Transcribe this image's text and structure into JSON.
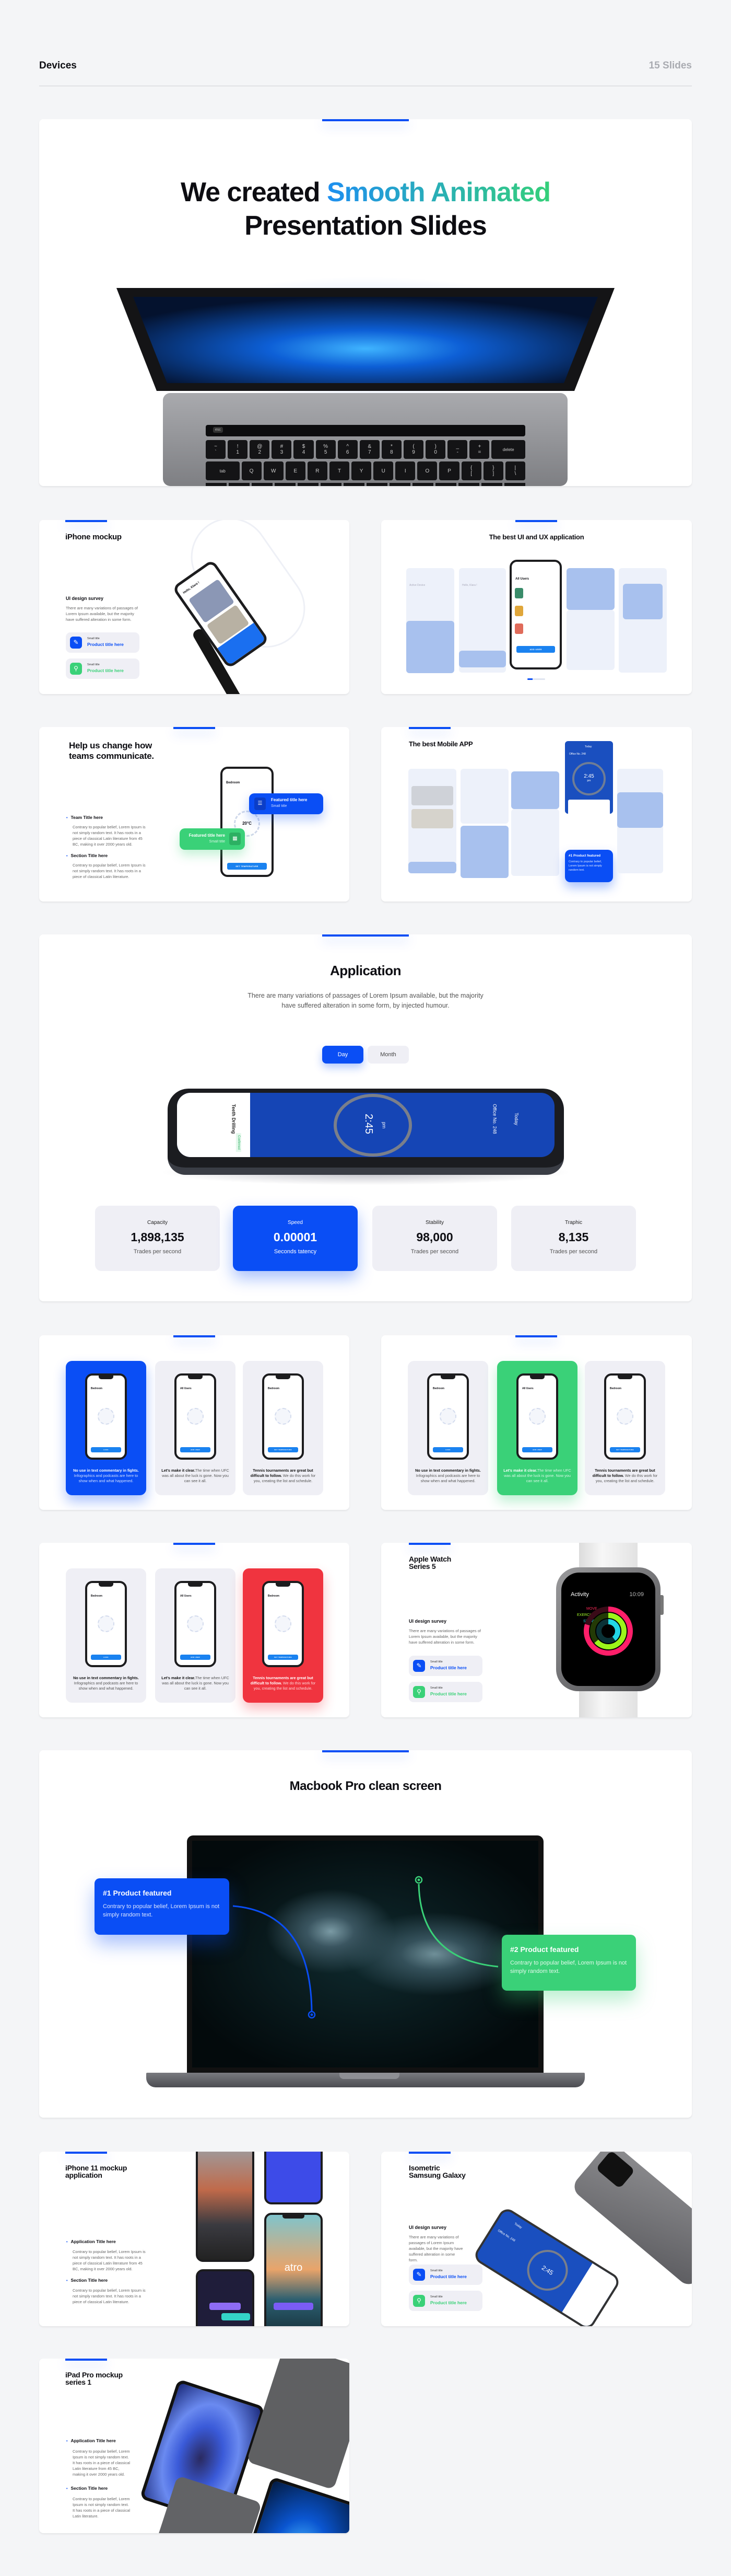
{
  "header": {
    "title": "Devices",
    "count": "15 Slides"
  },
  "colors": {
    "accent": "#0a4ef5",
    "green": "#3ad178",
    "red": "#f0343f",
    "background": "#f4f5f7"
  },
  "hero": {
    "title_start": "We created",
    "title_highlight": "Smooth Animated",
    "title_line2": "Presentation Slides",
    "keyboard": {
      "touchbar_key": "esc",
      "row1": [
        "~\n`",
        "!\n1",
        "@\n2",
        "#\n3",
        "$\n4",
        "%\n5",
        "^\n6",
        "&\n7",
        "*\n8",
        "(\n9",
        ")\n0",
        "_\n-",
        "+\n=",
        "delete"
      ],
      "row2": [
        "tab",
        "Q",
        "W",
        "E",
        "R",
        "T",
        "Y",
        "U",
        "I",
        "O",
        "P",
        "{\n[",
        "}\n]",
        "|\n\\"
      ]
    }
  },
  "survey": {
    "title": "UI design survey",
    "text": "There are many variations of passages of Lorem Ipsum available, but the majority have suffered alteration in some form.",
    "features": [
      {
        "small": "Small title",
        "title": "Product title here",
        "icon": "chart-pen-icon",
        "color": "#0a4ef5"
      },
      {
        "small": "Small title",
        "title": "Product title here",
        "icon": "head-search-icon",
        "color": "#3ad178"
      }
    ]
  },
  "iphone_mockup": {
    "title": "iPhone mockup",
    "phone_greeting": "Hello, Klara !"
  },
  "best_ui": {
    "title": "The best UI and UX application",
    "phone_heading": "All Users",
    "phone_button": "ADD USER",
    "side_labels": [
      "Active Device",
      "Hello, Klara !"
    ]
  },
  "help": {
    "title_line1": "Help us change how",
    "title_line2": "teams communicate.",
    "items": [
      {
        "title": "Team Title here",
        "text": "Contrary to popular belief, Lorem Ipsum is not simply random text. It has roots in a piece of classical Latin literature from 45 BC, making it over 2000 years old."
      },
      {
        "title": "Section Title here",
        "text": "Contrary to popular belief, Lorem Ipsum is not simply random text. It has roots in a piece of classical Latin literature."
      }
    ],
    "phone_heading": "Bedroom",
    "phone_temp": "20°C",
    "phone_button": "SET TEMPERATURE",
    "callouts": [
      {
        "title": "Featured title here",
        "small": "Small title"
      },
      {
        "title": "Featured title here",
        "small": "Small title"
      }
    ]
  },
  "best_mobile": {
    "title": "The best Mobile APP",
    "phone_office": "Office No. 248",
    "phone_day": "Today",
    "phone_time": "2:45",
    "phone_ampm": "pm",
    "callout_title": "#1 Product featured",
    "callout_text": "Contrary to popular belief, Lorem Ipsum is not simply random text."
  },
  "application": {
    "title": "Application",
    "description_line1": "There are many variations of passages of Lorem Ipsum available, but the majority",
    "description_line2": "have suffered alteration in some form, by injected humour.",
    "toggle": {
      "options": [
        "Day",
        "Month"
      ],
      "selected": "Day"
    },
    "phone": {
      "time": "2:45",
      "ampm": "pm",
      "office": "Office No. 248",
      "day": "Today",
      "task": "Teeth Drilling",
      "status": "Confirmed"
    },
    "stats": [
      {
        "label": "Capacity",
        "value": "1,898,135",
        "unit": "Trades per second"
      },
      {
        "label": "Speed",
        "value": "0.00001",
        "unit": "Seconds tatency"
      },
      {
        "label": "Stability",
        "value": "98,000",
        "unit": "Trades per second"
      },
      {
        "label": "Traphic",
        "value": "8,135",
        "unit": "Trades per second"
      }
    ]
  },
  "feature_trio": {
    "panels": [
      {
        "bold": "No use in text commentary in fights.",
        "rest": " Infographics and podcasts are here to show when and what happened.",
        "phone_heading": "Bedroom",
        "phone_button": "LOCK"
      },
      {
        "bold": "Let's make it clear.",
        "rest": "The time when UFC was all about the luck is gone. Now you can see it all.",
        "phone_heading": "All Users",
        "phone_button": "ADD USER"
      },
      {
        "bold": "Tennis tournaments are great but difficult to follow.",
        "rest": " We do this work for you, creating the list and schedule.",
        "phone_heading": "Bedroom",
        "phone_button": "SET TEMPERATURE"
      }
    ],
    "slides": [
      {
        "highlighted_panel": 0,
        "highlight_color": "#0a4ef5"
      },
      {
        "highlighted_panel": 1,
        "highlight_color": "#3ad178"
      },
      {
        "highlighted_panel": 2,
        "highlight_color": "#f0343f"
      }
    ]
  },
  "apple_watch": {
    "title_line1": "Apple Watch",
    "title_line2": "Series 5",
    "screen_title": "Activity",
    "screen_time": "10:09",
    "rings": [
      "MOVE",
      "EXERCISE",
      "STAND"
    ]
  },
  "macbook": {
    "title": "Macbook Pro clean screen",
    "callouts": [
      {
        "title": "#1 Product featured",
        "text": "Contrary to popular belief, Lorem Ipsum is not simply random text."
      },
      {
        "title": "#2 Product featured",
        "text": "Contrary to popular belief, Lorem Ipsum is not simply random text."
      }
    ]
  },
  "iphone11": {
    "title_line1": "iPhone 11 mockup",
    "title_line2": "application",
    "app_logo": "atro",
    "items": [
      {
        "title": "Application Title here",
        "text": "Contrary to popular belief, Lorem Ipsum is not simply random text. It has roots in a piece of classical Latin literature from 45 BC, making it over 2000 years old."
      },
      {
        "title": "Section Title here",
        "text": "Contrary to popular belief, Lorem Ipsum is not simply random text. It has roots in a piece of classical Latin literature."
      }
    ]
  },
  "samsung": {
    "title_line1": "Isometric",
    "title_line2": "Samsung Galaxy",
    "phone_time": "2:45",
    "phone_office": "Office No. 248",
    "phone_day": "Today"
  },
  "ipad": {
    "title_line1": "iPad Pro mockup",
    "title_line2": "series 1",
    "items": [
      {
        "title": "Application Title here",
        "text": "Contrary to popular belief, Lorem Ipsum is not simply random text. It has roots in a piece of classical Latin literature from 45 BC, making it over 2000 years old."
      },
      {
        "title": "Section Title here",
        "text": "Contrary to popular belief, Lorem Ipsum is not simply random text. It has roots in a piece of classical Latin literature."
      }
    ]
  }
}
